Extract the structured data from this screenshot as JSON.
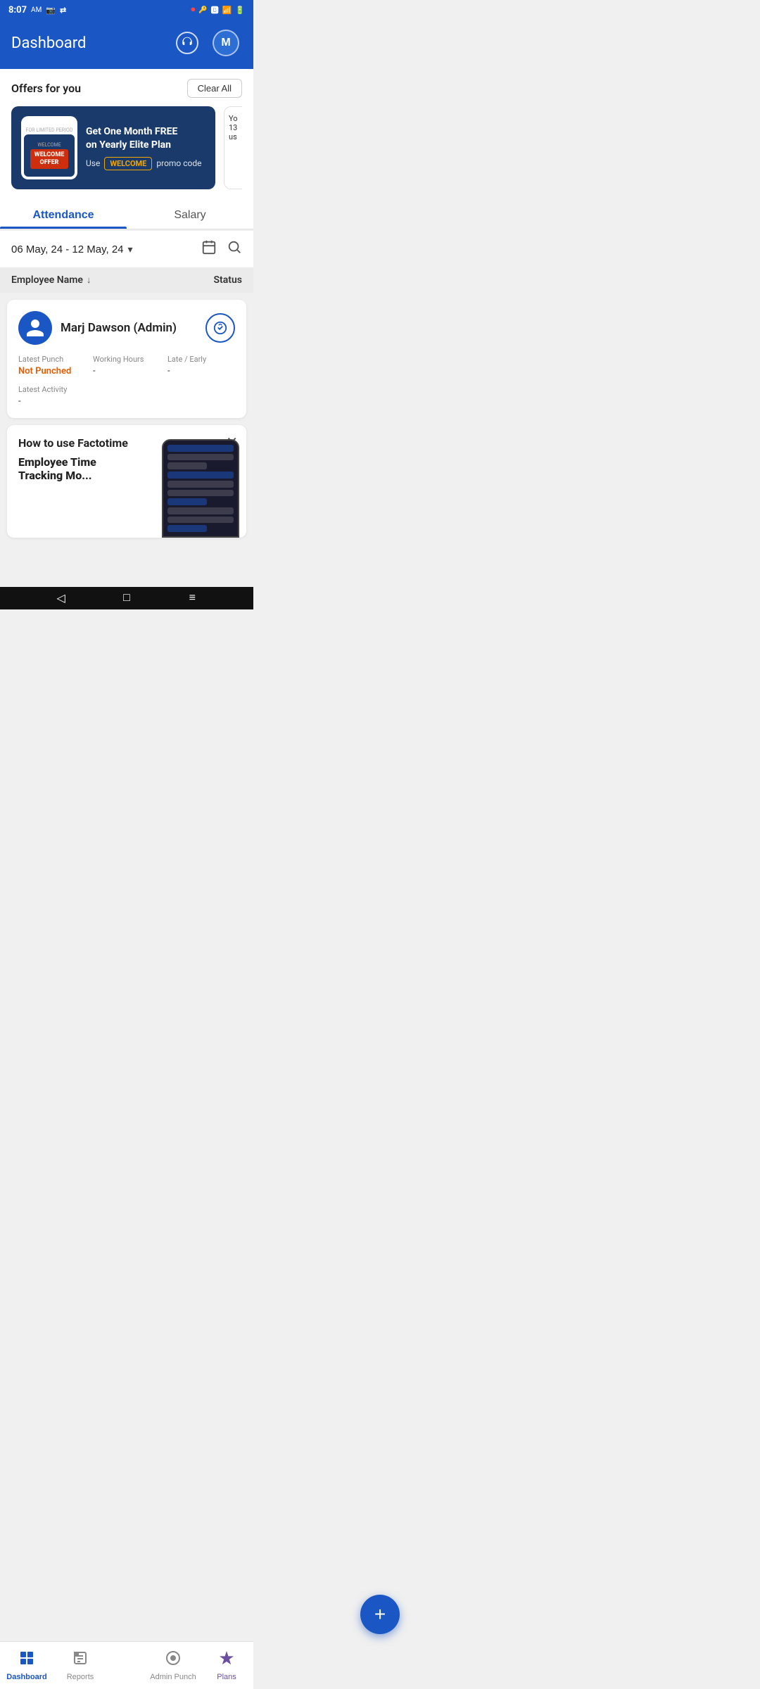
{
  "statusBar": {
    "time": "8:07",
    "ampm": "AM"
  },
  "header": {
    "title": "Dashboard",
    "supportLabel": "Support",
    "avatarInitial": "M"
  },
  "offersSection": {
    "title": "Offers for you",
    "clearAllLabel": "Clear All",
    "offerCard": {
      "limitedPeriodLabel": "FOR LIMITED PERIOD",
      "welcomeLabel": "WELCOME",
      "offerLabel": "OFFER",
      "headline": "Get One Month FRE\non Yearly Elite Plan",
      "promoPrefix": "Use",
      "promoCode": "WELCOME",
      "promoSuffix": "promo code"
    },
    "partialCard": {
      "line1": "Yo",
      "line2": "13",
      "line3": "us"
    }
  },
  "tabs": [
    {
      "id": "attendance",
      "label": "Attendance",
      "active": true
    },
    {
      "id": "salary",
      "label": "Salary",
      "active": false
    }
  ],
  "dateFilter": {
    "dateRange": "06 May, 24 - 12 May, 24"
  },
  "tableHeader": {
    "employeeName": "Employee Name",
    "status": "Status"
  },
  "employeeCard": {
    "name": "Marj Dawson (Admin)",
    "latestPunchLabel": "Latest Punch",
    "latestPunchValue": "Not Punched",
    "workingHoursLabel": "Working Hours",
    "workingHoursValue": "-",
    "lateEarlyLabel": "Late / Early",
    "lateEarlyValue": "-",
    "latestActivityLabel": "Latest Activity",
    "latestActivityValue": "-"
  },
  "howToCard": {
    "title": "How to use Factotime",
    "subtitle": "Employee Time\nTracking Mo..."
  },
  "fab": {
    "label": "+"
  },
  "bottomNav": [
    {
      "id": "dashboard",
      "label": "Dashboard",
      "active": true,
      "icon": "⊞"
    },
    {
      "id": "reports",
      "label": "Reports",
      "active": false,
      "icon": "📊"
    },
    {
      "id": "admin-punch",
      "label": "Admin Punch",
      "active": false,
      "icon": "⊙"
    },
    {
      "id": "plans",
      "label": "Plans",
      "active": false,
      "icon": "✦"
    }
  ],
  "sysNav": {
    "back": "◁",
    "home": "□",
    "menu": "≡"
  }
}
